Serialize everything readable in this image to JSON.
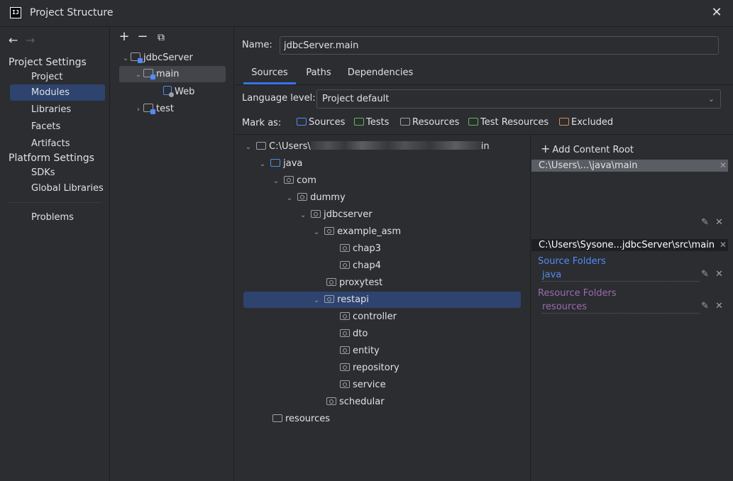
{
  "window": {
    "title": "Project Structure",
    "app_icon_text": "IJ"
  },
  "nav": {
    "back_icon": "arrow-left-icon",
    "forward_icon": "arrow-right-icon",
    "project_settings_title": "Project Settings",
    "project_settings_items": [
      "Project",
      "Modules",
      "Libraries",
      "Facets",
      "Artifacts"
    ],
    "platform_settings_title": "Platform Settings",
    "platform_settings_items": [
      "SDKs",
      "Global Libraries"
    ],
    "problems_label": "Problems",
    "selected": "Modules"
  },
  "modules_pane": {
    "toolbar": [
      "+",
      "−",
      "⧉"
    ],
    "tree": {
      "root": "jdbcServer",
      "main": "main",
      "web": "Web",
      "test": "test"
    }
  },
  "detail": {
    "name_label": "Name:",
    "name_value": "jdbcServer.main",
    "tabs": [
      "Sources",
      "Paths",
      "Dependencies"
    ],
    "active_tab": "Sources",
    "language_level_label": "Language level:",
    "language_level_value": "Project default",
    "mark_as_label": "Mark as:",
    "mark_as_buttons": [
      "Sources",
      "Tests",
      "Resources",
      "Test Resources",
      "Excluded"
    ],
    "source_tree": {
      "root_prefix": "C:\\Users\\",
      "root_suffix": "in",
      "java": "java",
      "com": "com",
      "dummy": "dummy",
      "jdbcserver": "jdbcserver",
      "example_asm": "example_asm",
      "chap3": "chap3",
      "chap4": "chap4",
      "proxytest": "proxytest",
      "restapi": "restapi",
      "controller": "controller",
      "dto": "dto",
      "entity": "entity",
      "repository": "repository",
      "service": "service",
      "schedular": "schedular",
      "resources": "resources"
    },
    "content_roots": {
      "add_label": "Add Content Root",
      "root1": "C:\\Users\\...\\java\\main",
      "root2": "C:\\Users\\Sysone...jdbcServer\\src\\main",
      "source_folders_title": "Source Folders",
      "source_folder": "java",
      "resource_folders_title": "Resource Folders",
      "resource_folder": "resources"
    }
  },
  "colors": {
    "source_blue": "#548af7",
    "resource_purple": "#9b6bb0",
    "test_green": "#5fb865",
    "test_res_orange": "#d9a343",
    "excluded_orange": "#d98c4e",
    "selection": "#2e436e"
  }
}
